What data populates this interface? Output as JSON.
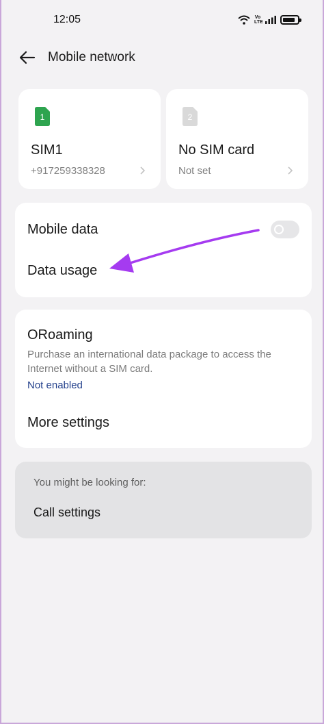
{
  "status_bar": {
    "time": "12:05",
    "volte_label": "Vo\nLTE",
    "battery_level": 0.85
  },
  "header": {
    "title": "Mobile network",
    "back_icon": "arrow-left-icon"
  },
  "sim_cards": [
    {
      "slot": "1",
      "name": "SIM1",
      "subtitle": "+917259338328",
      "icon_color": "#2ea44f",
      "active": true
    },
    {
      "slot": "2",
      "name": "No SIM card",
      "subtitle": "Not set",
      "icon_color": "#d9d9d9",
      "active": false
    }
  ],
  "data_section": {
    "mobile_data_label": "Mobile data",
    "mobile_data_enabled": false,
    "data_usage_label": "Data usage"
  },
  "roaming": {
    "title": "ORoaming",
    "description": "Purchase an international data package to access the Internet without a SIM card.",
    "status": "Not enabled",
    "more_settings_label": "More settings"
  },
  "suggestions": {
    "heading": "You might be looking for:",
    "items": [
      "Call settings"
    ]
  },
  "colors": {
    "background": "#f3f2f4",
    "card": "#ffffff",
    "accent_link": "#24418c",
    "annotation_arrow": "#a53bf0"
  }
}
